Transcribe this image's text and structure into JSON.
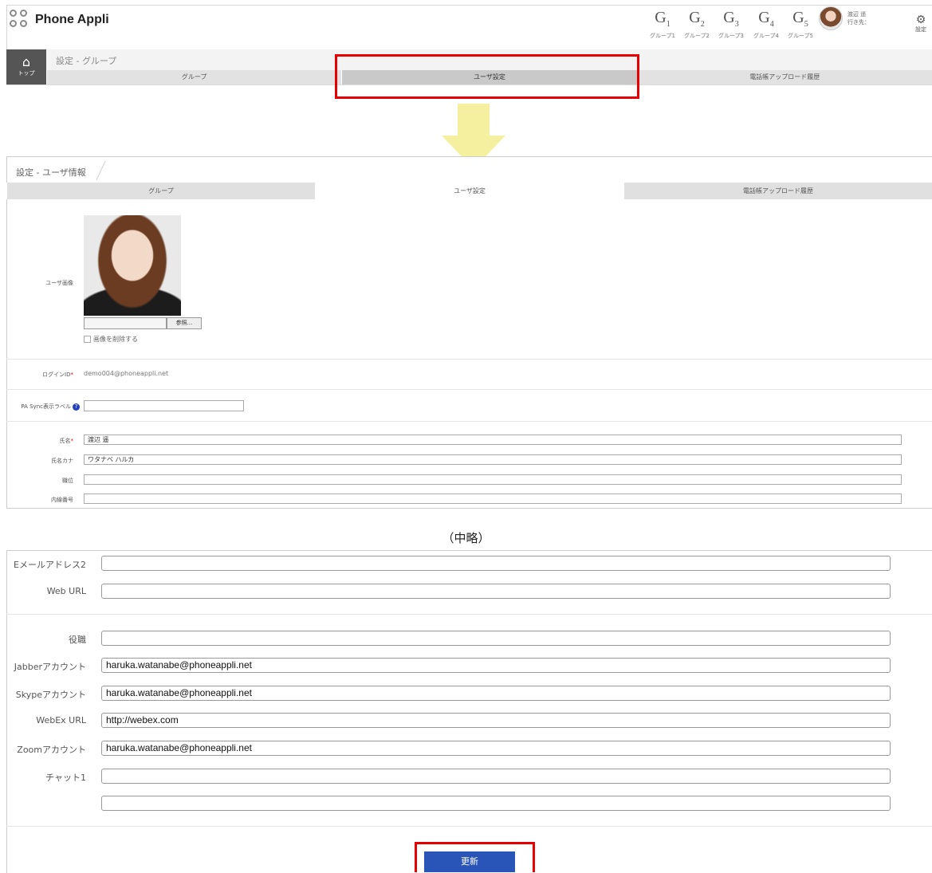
{
  "header": {
    "logo_text": "Phone Appli",
    "groups": [
      {
        "letter": "G",
        "num": "1",
        "label": "グループ1"
      },
      {
        "letter": "G",
        "num": "2",
        "label": "グループ2"
      },
      {
        "letter": "G",
        "num": "3",
        "label": "グループ3"
      },
      {
        "letter": "G",
        "num": "4",
        "label": "グループ4"
      },
      {
        "letter": "G",
        "num": "5",
        "label": "グループ5"
      }
    ],
    "user_name": "渡辺 遥",
    "user_status": "行き先：",
    "settings_label": "設定"
  },
  "nav1": {
    "home_label": "トップ",
    "breadcrumb": "設定 - グループ",
    "tabs": [
      "グループ",
      "ユーザ設定",
      "電話帳アップロード履歴"
    ]
  },
  "screen2": {
    "breadcrumb": "設定 - ユーザ情報",
    "tabs": [
      "グループ",
      "ユーザ設定",
      "電話帳アップロード履歴"
    ],
    "photo_label": "ユーザ画像",
    "browse_label": "参照...",
    "delete_image_label": "画像を削除する",
    "login_id_label": "ログインID",
    "login_id_value": "demo004@phoneappli.net",
    "pa_sync_label": "PA Sync表示ラベル",
    "name_label": "氏名",
    "name_value": "渡辺 遥",
    "kana_label": "氏名カナ",
    "kana_value": "ワタナベ ハルカ",
    "job_label": "職位",
    "ext_label": "内線番号"
  },
  "omitted_note": "（中略）",
  "screen3": {
    "email2_label": "Eメールアドレス2",
    "web_url_label": "Web URL",
    "role_label": "役職",
    "jabber_label": "Jabberアカウント",
    "jabber_value": "haruka.watanabe@phoneappli.net",
    "skype_label": "Skypeアカウント",
    "skype_value": "haruka.watanabe@phoneappli.net",
    "webex_label": "WebEx URL",
    "webex_value": "http://webex.com",
    "zoom_label": "Zoomアカウント",
    "zoom_value": "haruka.watanabe@phoneappli.net",
    "chat1_label": "チャット1",
    "update_label": "更新"
  },
  "colors": {
    "highlight": "#e60000",
    "arrow": "#f5f0a0",
    "update_button": "#2a55b8"
  }
}
